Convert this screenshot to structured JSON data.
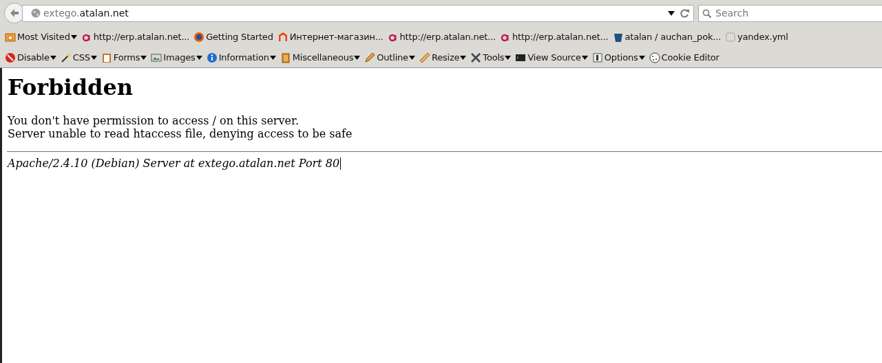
{
  "address_bar": {
    "host_prefix": "extego.",
    "domain": "atalan.net"
  },
  "search": {
    "placeholder": "Search"
  },
  "bookmarks": [
    {
      "label": "Most Visited",
      "menu": true
    },
    {
      "label": "http://erp.atalan.net...",
      "menu": false
    },
    {
      "label": "Getting Started",
      "menu": false
    },
    {
      "label": "Интернет-магазин...",
      "menu": false
    },
    {
      "label": "http://erp.atalan.net...",
      "menu": false
    },
    {
      "label": "http://erp.atalan.net...",
      "menu": false
    },
    {
      "label": "atalan / auchan_pok...",
      "menu": false
    },
    {
      "label": "yandex.yml",
      "menu": false
    }
  ],
  "dev_toolbar": [
    {
      "label": "Disable",
      "menu": true
    },
    {
      "label": "CSS",
      "menu": true
    },
    {
      "label": "Forms",
      "menu": true
    },
    {
      "label": "Images",
      "menu": true
    },
    {
      "label": "Information",
      "menu": true
    },
    {
      "label": "Miscellaneous",
      "menu": true
    },
    {
      "label": "Outline",
      "menu": true
    },
    {
      "label": "Resize",
      "menu": true
    },
    {
      "label": "Tools",
      "menu": true
    },
    {
      "label": "View Source",
      "menu": true
    },
    {
      "label": "Options",
      "menu": true
    },
    {
      "label": "Cookie Editor",
      "menu": false
    }
  ],
  "page": {
    "heading": "Forbidden",
    "paragraph_lines": [
      "You don't have permission to access / on this server.",
      "Server unable to read htaccess file, denying access to be safe"
    ],
    "signature": "Apache/2.4.10 (Debian) Server at extego.atalan.net Port 80"
  }
}
